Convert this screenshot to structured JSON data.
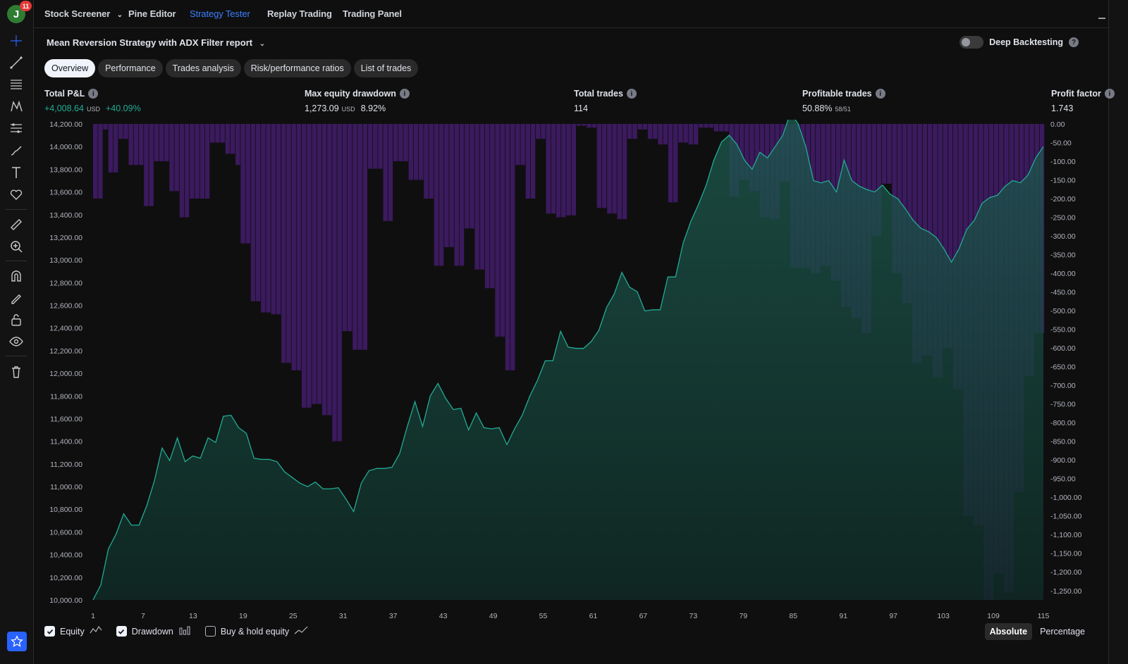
{
  "user": {
    "avatar_letter": "J",
    "notifications": "11"
  },
  "nav": {
    "items": [
      "Stock Screener",
      "Pine Editor",
      "Strategy Tester",
      "Replay Trading",
      "Trading Panel"
    ]
  },
  "report": {
    "title": "Mean Reversion Strategy with ADX Filter report",
    "deep_backtesting": "Deep Backtesting"
  },
  "tabs": [
    "Overview",
    "Performance",
    "Trades analysis",
    "Risk/performance ratios",
    "List of trades"
  ],
  "metrics": {
    "total_pnl": {
      "label": "Total P&L",
      "value": "+4,008.64",
      "unit": "USD",
      "pct": "+40.09%"
    },
    "max_dd": {
      "label": "Max equity drawdown",
      "value": "1,273.09",
      "unit": "USD",
      "pct": "8.92%"
    },
    "total_trades": {
      "label": "Total trades",
      "value": "114"
    },
    "profitable": {
      "label": "Profitable trades",
      "value": "50.88%",
      "sub": "58/51"
    },
    "profit_factor": {
      "label": "Profit factor",
      "value": "1.743"
    }
  },
  "legend": {
    "equity": "Equity",
    "drawdown": "Drawdown",
    "buyhold": "Buy & hold equity"
  },
  "modes": {
    "absolute": "Absolute",
    "percentage": "Percentage"
  },
  "colors": {
    "equity_fill": "#0f3a32",
    "equity_line": "#22ab94",
    "drawdown": "#3b1a5e",
    "accent": "#2962ff"
  },
  "chart_data": {
    "type": "area",
    "left_axis": {
      "ylim": [
        10000,
        14200
      ],
      "ticks": [
        "14,200.00",
        "14,000.00",
        "13,800.00",
        "13,600.00",
        "13,400.00",
        "13,200.00",
        "13,000.00",
        "12,800.00",
        "12,600.00",
        "12,400.00",
        "12,200.00",
        "12,000.00",
        "11,800.00",
        "11,600.00",
        "11,400.00",
        "11,200.00",
        "11,000.00",
        "10,800.00",
        "10,600.00",
        "10,400.00",
        "10,200.00",
        "10,000.00"
      ]
    },
    "right_axis": {
      "ylim": [
        -1275,
        0
      ],
      "ticks": [
        "0.00",
        "-50.00",
        "-100.00",
        "-150.00",
        "-200.00",
        "-250.00",
        "-300.00",
        "-350.00",
        "-400.00",
        "-450.00",
        "-500.00",
        "-550.00",
        "-600.00",
        "-650.00",
        "-700.00",
        "-750.00",
        "-800.00",
        "-850.00",
        "-900.00",
        "-950.00",
        "-1,000.00",
        "-1,050.00",
        "-1,100.00",
        "-1,150.00",
        "-1,200.00",
        "-1,250.00"
      ]
    },
    "x_ticks": [
      "1",
      "7",
      "13",
      "19",
      "25",
      "31",
      "37",
      "43",
      "49",
      "55",
      "61",
      "67",
      "73",
      "79",
      "85",
      "91",
      "97",
      "103",
      "109",
      "115"
    ],
    "series": [
      {
        "name": "Equity",
        "values": [
          10000,
          10130,
          10450,
          10580,
          10760,
          10660,
          10660,
          10830,
          11050,
          11340,
          11230,
          11430,
          11220,
          11270,
          11250,
          11430,
          11390,
          11620,
          11630,
          11520,
          11470,
          11250,
          11240,
          11240,
          11220,
          11130,
          11080,
          11030,
          11000,
          11040,
          10980,
          10980,
          10990,
          10890,
          10780,
          11030,
          11140,
          11160,
          11160,
          11170,
          11290,
          11530,
          11750,
          11530,
          11800,
          11910,
          11780,
          11680,
          11690,
          11500,
          11650,
          11520,
          11510,
          11520,
          11370,
          11510,
          11630,
          11800,
          11940,
          12110,
          12110,
          12370,
          12230,
          12220,
          12220,
          12280,
          12380,
          12580,
          12700,
          12890,
          12760,
          12720,
          12550,
          12560,
          12560,
          12850,
          12850,
          13150,
          13340,
          13490,
          13660,
          13880,
          14040,
          14100,
          14020,
          13880,
          13800,
          13950,
          13900,
          14000,
          14100,
          14300,
          14200,
          14000,
          13700,
          13680,
          13700,
          13600,
          13880,
          13700,
          13650,
          13620,
          13600,
          13660,
          13580,
          13540,
          13450,
          13350,
          13280,
          13250,
          13200,
          13100,
          12980,
          13100,
          13270,
          13350,
          13500,
          13550,
          13570,
          13650,
          13700,
          13680,
          13750,
          13900,
          14000
        ]
      },
      {
        "name": "Drawdown",
        "values": [
          -200,
          -200,
          -15,
          -130,
          -130,
          -40,
          -40,
          -110,
          -110,
          -110,
          -220,
          -220,
          -100,
          -100,
          -100,
          -180,
          -180,
          -250,
          -250,
          -200,
          -200,
          -200,
          -200,
          -50,
          -50,
          -50,
          -80,
          -80,
          -110,
          -320,
          -320,
          -475,
          -475,
          -505,
          -505,
          -510,
          -510,
          -640,
          -640,
          -660,
          -660,
          -760,
          -760,
          -750,
          -750,
          -780,
          -780,
          -850,
          -850,
          -555,
          -555,
          -605,
          -605,
          -605,
          -120,
          -120,
          -120,
          -260,
          -260,
          -100,
          -100,
          -100,
          -150,
          -150,
          -150,
          -200,
          -200,
          -380,
          -380,
          -330,
          -330,
          -380,
          -380,
          -280,
          -280,
          -390,
          -390,
          -440,
          -440,
          -570,
          -570,
          -660,
          -660,
          -110,
          -110,
          -200,
          -200,
          -40,
          -40,
          -240,
          -240,
          -250,
          -250,
          -245,
          -245,
          -5,
          -5,
          -10,
          -10,
          -225,
          -225,
          -240,
          -240,
          -255,
          -255,
          -40,
          -40,
          -15,
          -15,
          -40,
          -40,
          -55,
          -55,
          -210,
          -210,
          -50,
          -50,
          -55,
          -55,
          -10,
          -10,
          -10,
          -20,
          -20,
          -20,
          -195,
          -195,
          -150,
          -150,
          -180,
          -180,
          -250,
          -250,
          -255,
          -255,
          -155,
          -155,
          -385,
          -385,
          -385,
          -385,
          -400,
          -400,
          -380,
          -380,
          -420,
          -420,
          -490,
          -490,
          -520,
          -520,
          -560,
          -560,
          -300,
          -300,
          -160,
          -160,
          -400,
          -400,
          -480,
          -480,
          -640,
          -640,
          -620,
          -620,
          -680,
          -680,
          -600,
          -600,
          -710,
          -710,
          -1050,
          -1050,
          -1075,
          -1075,
          -1275,
          -1275,
          -1205,
          -1205,
          -1255,
          -1255,
          -985,
          -985,
          -675,
          -675,
          -560,
          -560
        ]
      }
    ]
  }
}
